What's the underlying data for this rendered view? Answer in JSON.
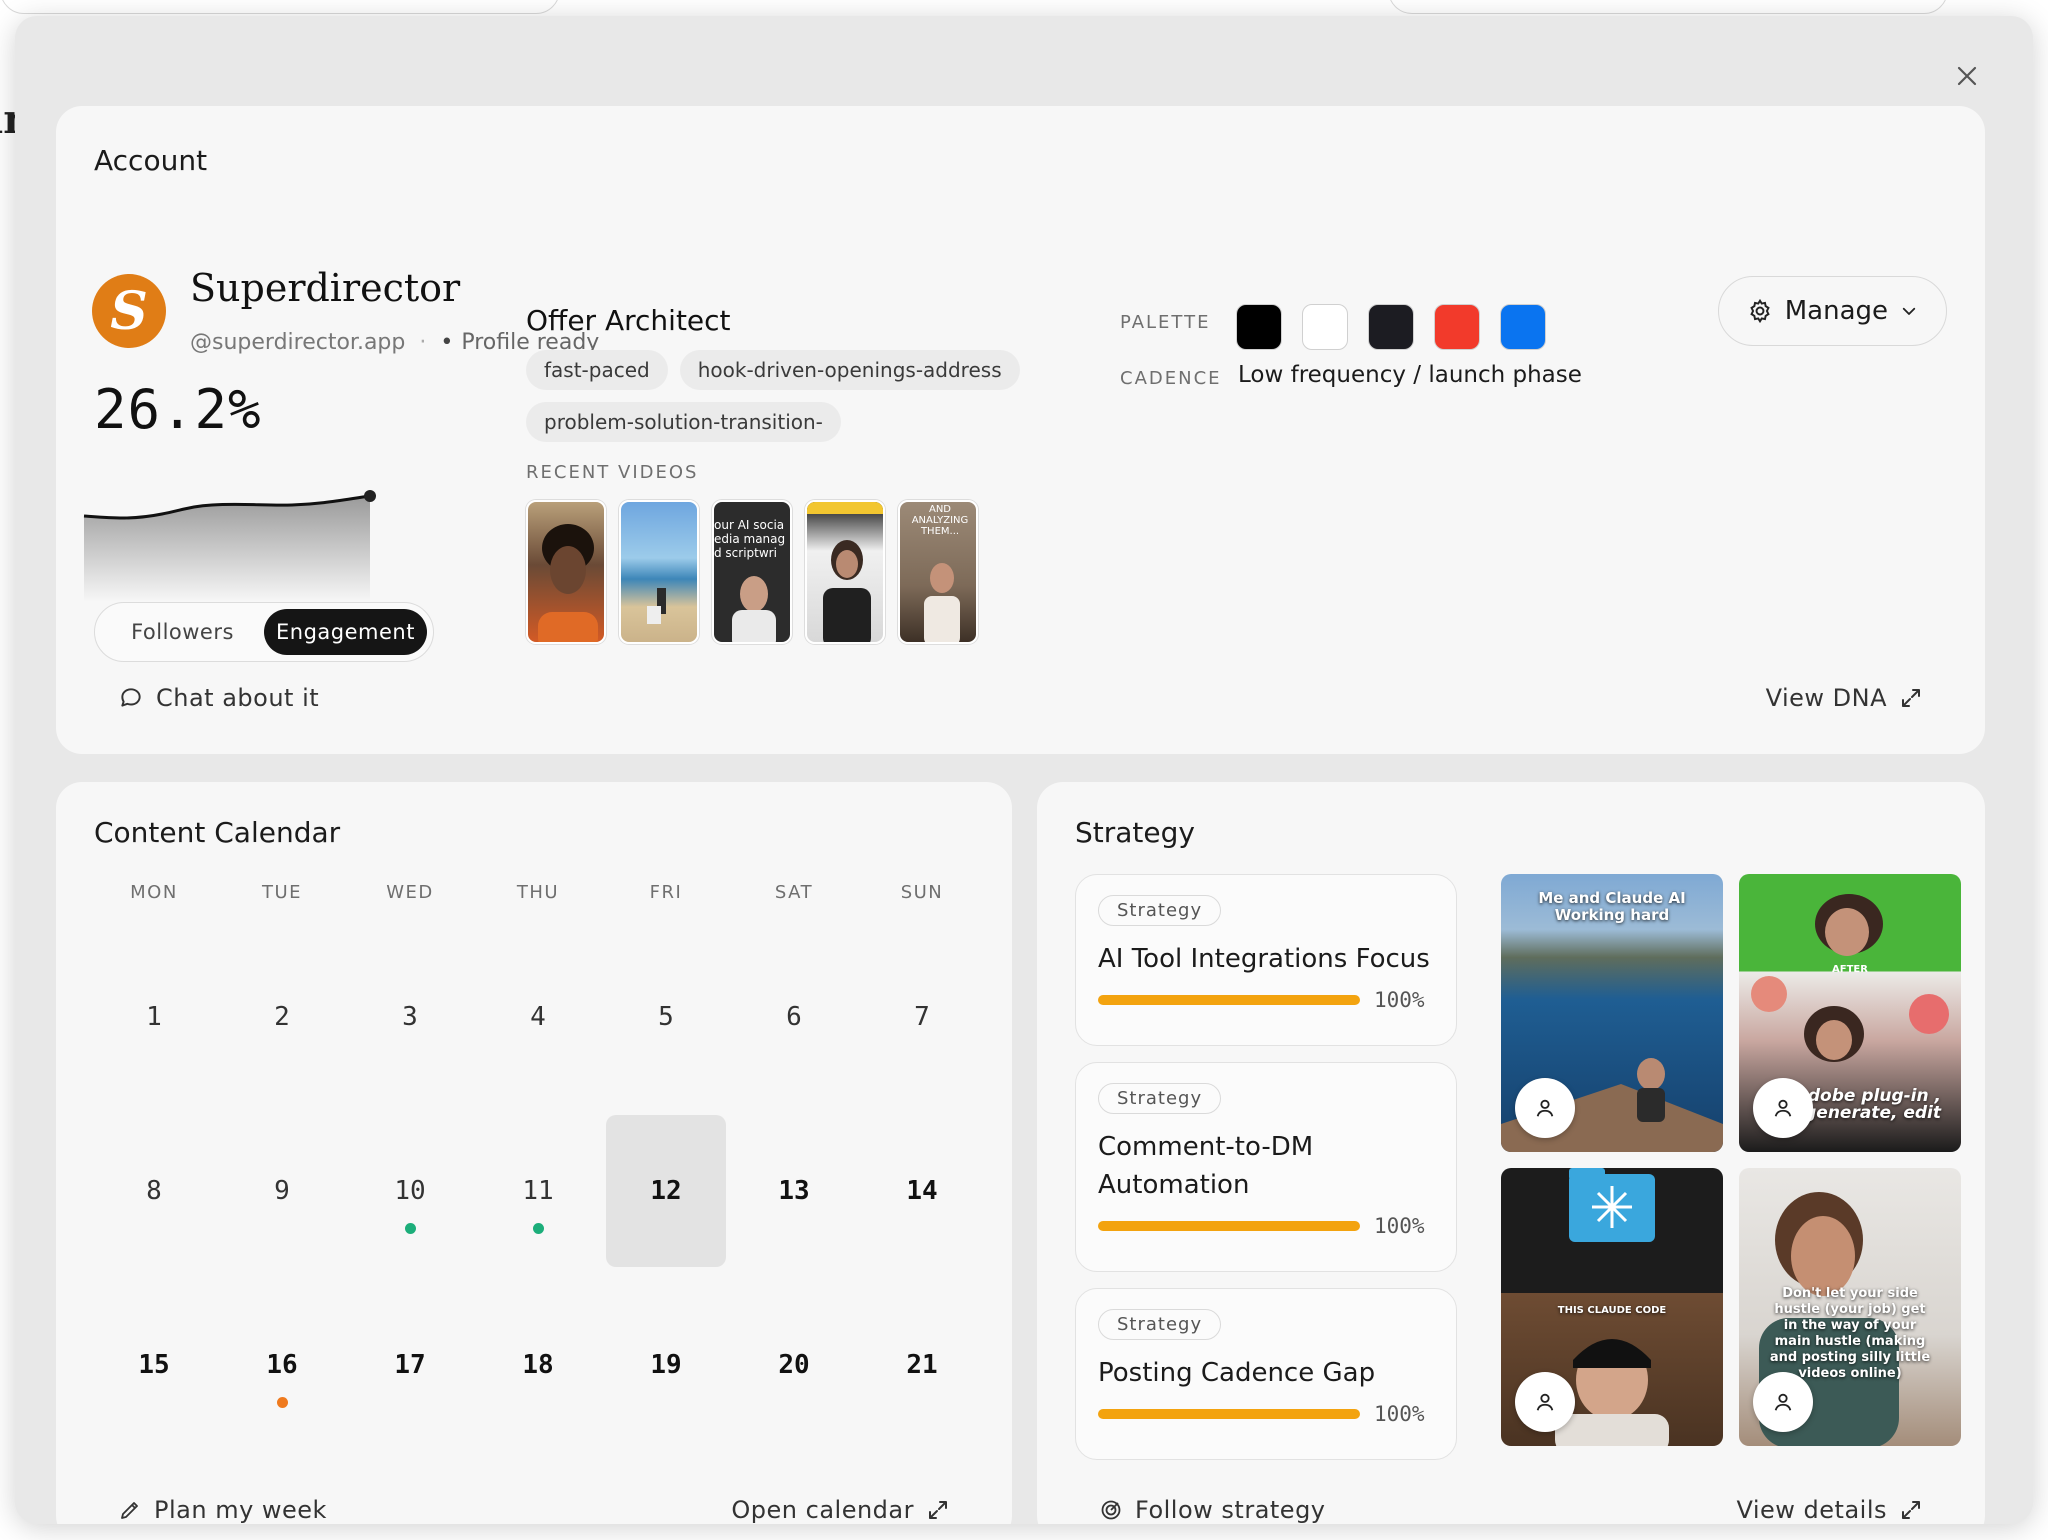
{
  "modal": {
    "close_icon": "close-icon"
  },
  "account": {
    "title": "Account",
    "brand_initial": "S",
    "brand_name": "Superdirector",
    "handle": "@superdirector.app",
    "separator": "·",
    "status": "Profile ready",
    "manage_label": "Manage",
    "metric_value": "26.2%",
    "toggle": {
      "followers": "Followers",
      "engagement": "Engagement",
      "active": "Engagement"
    },
    "offer_title": "Offer Architect",
    "tags": [
      "fast-paced",
      "hook-driven-openings-address",
      "problem-solution-transition-"
    ],
    "recent_videos_label": "RECENT VIDEOS",
    "palette_label": "PALETTE",
    "palette": [
      "#000000",
      "#ffffff",
      "#1c1c22",
      "#f23a2b",
      "#0a74f0"
    ],
    "cadence_label": "CADENCE",
    "cadence_value": "Low frequency / launch phase",
    "chat_label": "Chat about it",
    "view_dna_label": "View DNA",
    "video_texts": [
      "our AI socia",
      "edia manag",
      "d scriptwri",
      "AND\nANALYZING\nTHEM..."
    ]
  },
  "calendar": {
    "title": "Content Calendar",
    "weekdays": [
      "MON",
      "TUE",
      "WED",
      "THU",
      "FRI",
      "SAT",
      "SUN"
    ],
    "weeks": [
      [
        {
          "d": "1"
        },
        {
          "d": "2"
        },
        {
          "d": "3"
        },
        {
          "d": "4"
        },
        {
          "d": "5"
        },
        {
          "d": "6"
        },
        {
          "d": "7"
        }
      ],
      [
        {
          "d": "8"
        },
        {
          "d": "9"
        },
        {
          "d": "10",
          "dot": "#1cae7a"
        },
        {
          "d": "11",
          "dot": "#1cae7a"
        },
        {
          "d": "12",
          "today": true
        },
        {
          "d": "13",
          "bold": true
        },
        {
          "d": "14",
          "bold": true
        }
      ],
      [
        {
          "d": "15",
          "bold": true
        },
        {
          "d": "16",
          "bold": true,
          "dot": "#ef7a1e"
        },
        {
          "d": "17",
          "bold": true
        },
        {
          "d": "18",
          "bold": true
        },
        {
          "d": "19",
          "bold": true
        },
        {
          "d": "20",
          "bold": true
        },
        {
          "d": "21",
          "bold": true
        }
      ]
    ],
    "plan_label": "Plan my week",
    "open_label": "Open calendar"
  },
  "strategy": {
    "title": "Strategy",
    "items": [
      {
        "badge": "Strategy",
        "title": "AI Tool Integrations Focus",
        "pct": "100%"
      },
      {
        "badge": "Strategy",
        "title": "Comment-to-DM Automation",
        "pct": "100%"
      },
      {
        "badge": "Strategy",
        "title": "Posting Cadence Gap",
        "pct": "100%"
      }
    ],
    "tiles": [
      {
        "caption": "Me and Claude AI Working hard"
      },
      {
        "caption": "dobe plug-in , generate, edit",
        "label": "AFTER"
      },
      {
        "caption": "THIS CLAUDE CODE"
      },
      {
        "caption": "Don't let your side hustle (your job) get in the way of your main hustle (making and posting silly little videos online)"
      }
    ],
    "follow_label": "Follow strategy",
    "details_label": "View details"
  }
}
